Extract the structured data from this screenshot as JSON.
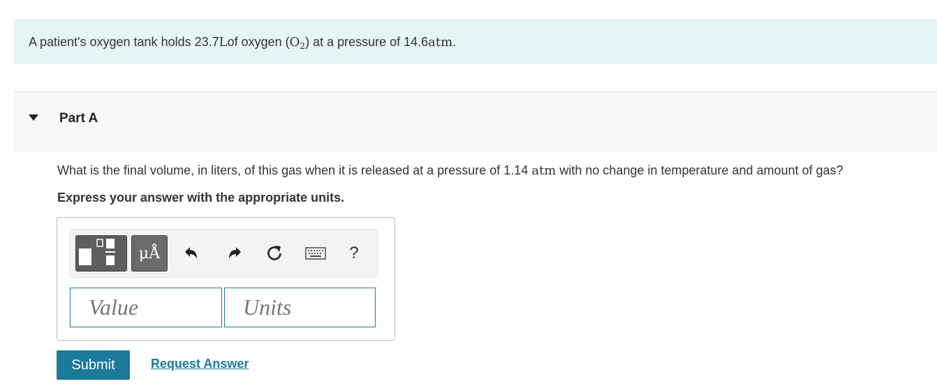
{
  "problem": {
    "text_1": "A patient's oxygen tank holds 23.7 ",
    "unit_volume": "L",
    "text_2": " of oxygen (",
    "formula_main": "O",
    "formula_sub": "2",
    "text_3": ") at a pressure of 14.6 ",
    "unit_pressure": "atm",
    "text_4": "."
  },
  "part": {
    "title": "Part A",
    "question_1": "What is the final volume, in liters, of this gas when it is released at a pressure of 1.14 ",
    "question_unit": "atm",
    "question_2": " with no change in temperature and amount of gas?",
    "instruction": "Express your answer with the appropriate units."
  },
  "toolbar": {
    "units_button_label": "μÅ",
    "help_label": "?",
    "icons": [
      "templates-icon",
      "units-icon",
      "undo-icon",
      "redo-icon",
      "reset-icon",
      "keyboard-icon",
      "help-icon"
    ]
  },
  "answer": {
    "value_placeholder": "Value",
    "units_placeholder": "Units"
  },
  "actions": {
    "submit_label": "Submit",
    "request_label": "Request Answer"
  },
  "colors": {
    "problem_background": "#e6f5f5",
    "accent": "#1a7a9a",
    "field_border": "#1f7a8c"
  }
}
